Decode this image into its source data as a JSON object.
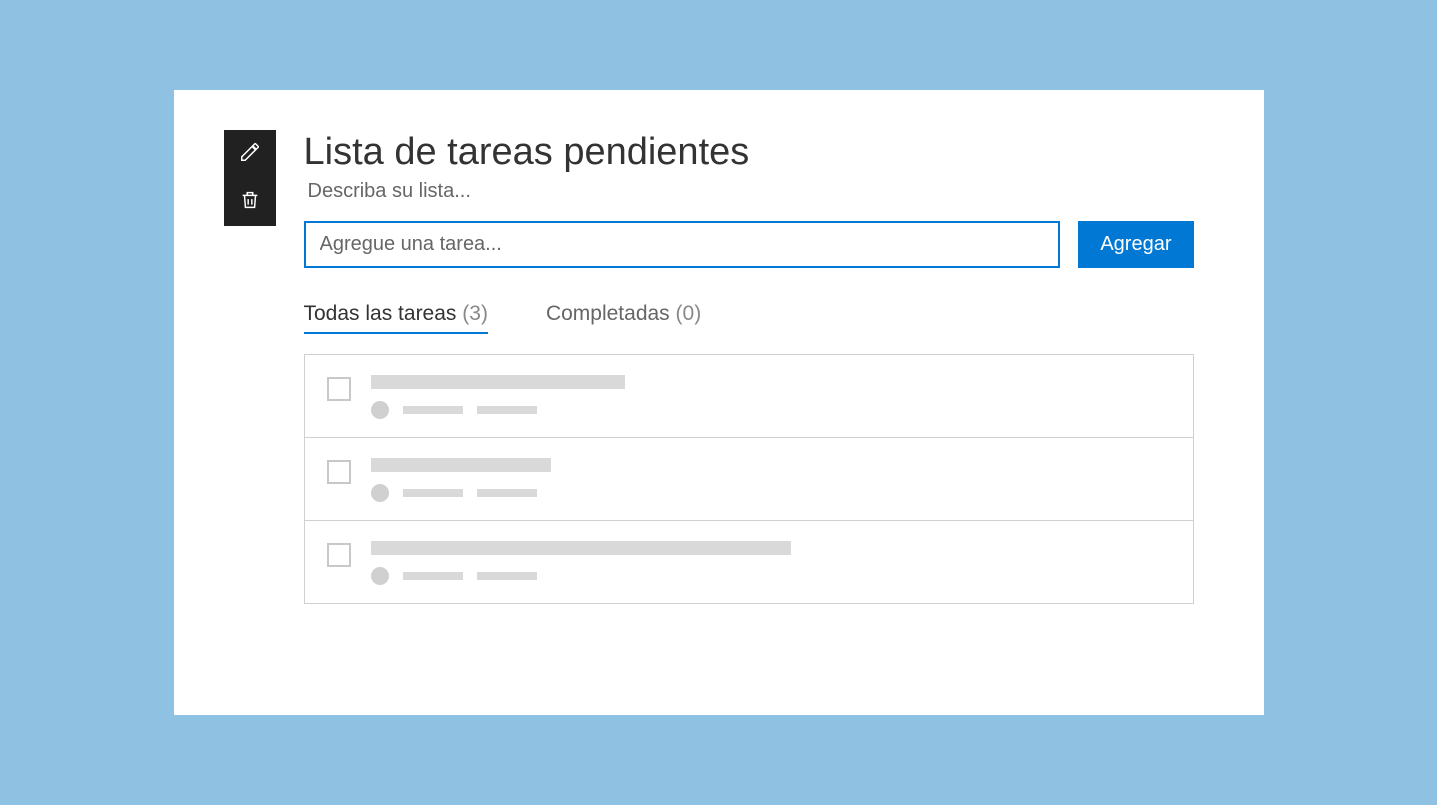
{
  "header": {
    "title": "Lista de tareas pendientes",
    "subtitle": "Describa su lista..."
  },
  "input": {
    "placeholder": "Agregue una tarea...",
    "add_label": "Agregar"
  },
  "tabs": {
    "all": {
      "label": "Todas las tareas",
      "count": "(3)"
    },
    "completed": {
      "label": "Completadas",
      "count": "(0)"
    }
  }
}
